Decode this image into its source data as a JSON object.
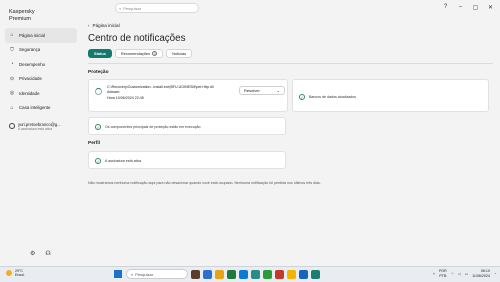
{
  "app": {
    "title_line1": "Kaspersky",
    "title_line2": "Premium"
  },
  "search": {
    "placeholder": "Pesquisar"
  },
  "window_controls": {
    "help": "?",
    "minimize": "–",
    "maximize": "▢",
    "close": "✕"
  },
  "sidebar": {
    "items": [
      {
        "label": "Página inicial",
        "icon": "home-icon"
      },
      {
        "label": "Segurança",
        "icon": "shield-icon"
      },
      {
        "label": "Desempenho",
        "icon": "speed-icon"
      },
      {
        "label": "Privacidade",
        "icon": "privacy-icon"
      },
      {
        "label": "Identidade",
        "icon": "id-icon"
      },
      {
        "label": "Casa inteligente",
        "icon": "house-icon"
      }
    ],
    "profile": {
      "email": "yuri.pretoebranco@g...",
      "status": "A assinatura está ativa"
    }
  },
  "main": {
    "breadcrumb": "Página inicial",
    "title": "Centro de notificações",
    "tabs": [
      {
        "label": "Status",
        "active": true
      },
      {
        "label": "Recomendações",
        "badge": "0"
      },
      {
        "label": "Notícias"
      }
    ],
    "protection": {
      "title": "Proteção",
      "threat_path": "C:\\Recovery\\Customization...install.exe|BFU.UGINESM\\pet.Http.dll",
      "threat_type": "Adware:",
      "threat_name": "Hora 10/06/2024 22:45",
      "resolve_label": "Resolver",
      "db_status": "Bancos de dados atualizados",
      "components_status": "Os componentes principais de proteção estão em execução"
    },
    "profile_section": {
      "title": "Perfil",
      "subscription": "A assinatura está ativa"
    },
    "footer_note": "Não mostramos nenhuma notificação aqui para não desanimar quando você está ocupado. Nenhuma notificação foi perdida nos últimos três dias."
  },
  "taskbar": {
    "weather_temp": "29°C",
    "weather_desc": "Ensol.",
    "search_placeholder": "Pesquisar",
    "lang_top": "POR",
    "lang_bottom": "PTB",
    "time": "06:10",
    "date": "11/06/2024"
  }
}
